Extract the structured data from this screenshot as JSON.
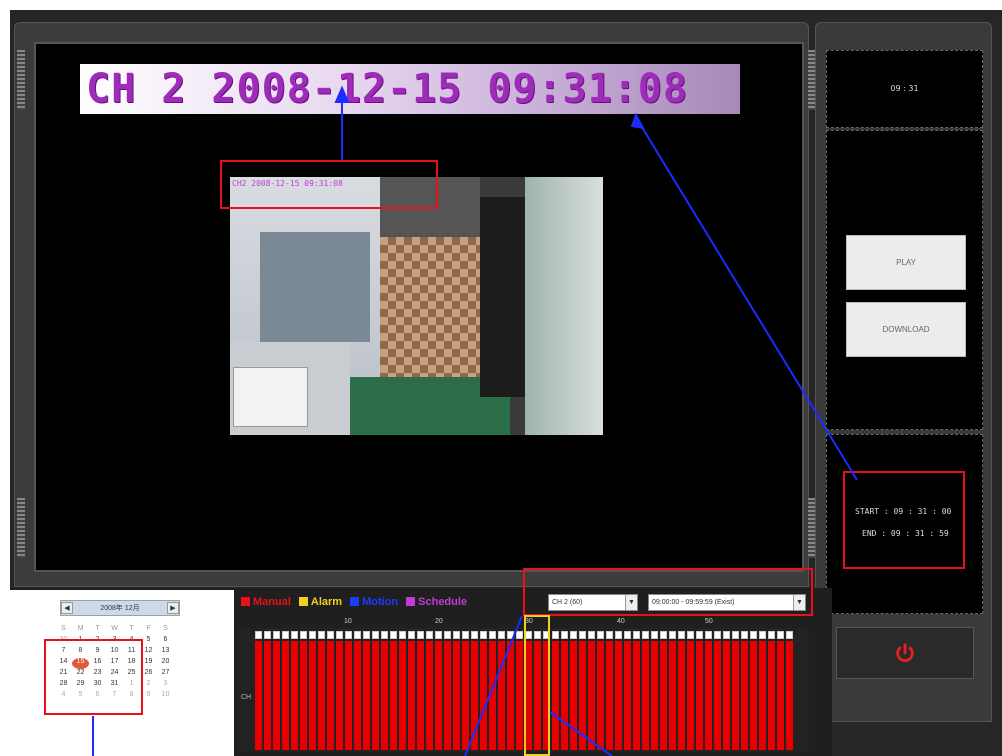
{
  "osd": {
    "zoom_text": "CH 2 2008-12-15 09:31:08",
    "small_text": "CH2 2008-12-15 09:31:08"
  },
  "right": {
    "clock": "09 : 31",
    "play_label": "PLAY",
    "download_label": "DOWNLOAD",
    "start_text": "START : 09 : 31 : 00",
    "end_text": "END : 09 : 31 : 59"
  },
  "calendar": {
    "month_label": "2008年 12月",
    "headers": [
      "S",
      "M",
      "T",
      "W",
      "T",
      "F",
      "S"
    ],
    "rows": [
      [
        "30",
        "1",
        "2",
        "3",
        "4",
        "5",
        "6"
      ],
      [
        "7",
        "8",
        "9",
        "10",
        "11",
        "12",
        "13"
      ],
      [
        "14",
        "15",
        "16",
        "17",
        "18",
        "19",
        "20"
      ],
      [
        "21",
        "22",
        "23",
        "24",
        "25",
        "26",
        "27"
      ],
      [
        "28",
        "29",
        "30",
        "31",
        "1",
        "2",
        "3"
      ],
      [
        "4",
        "5",
        "6",
        "7",
        "8",
        "9",
        "10"
      ]
    ],
    "selected": "15"
  },
  "legend": [
    {
      "label": "Manual",
      "color": "#e8101a"
    },
    {
      "label": "Alarm",
      "color": "#f0d020"
    },
    {
      "label": "Motion",
      "color": "#1a3cff"
    },
    {
      "label": "Schedule",
      "color": "#c23bd6"
    }
  ],
  "channel_select": "CH 2 (60)",
  "time_select": "09:00:00 - 09:59:59 (Exist)",
  "timeline": {
    "ticks": [
      "10",
      "20",
      "30",
      "40",
      "50"
    ],
    "channel_label": "CH",
    "segments": 60
  },
  "colors": {
    "record": "#e80000",
    "highlight": "#e8101a",
    "cursor": "#f0d020"
  }
}
